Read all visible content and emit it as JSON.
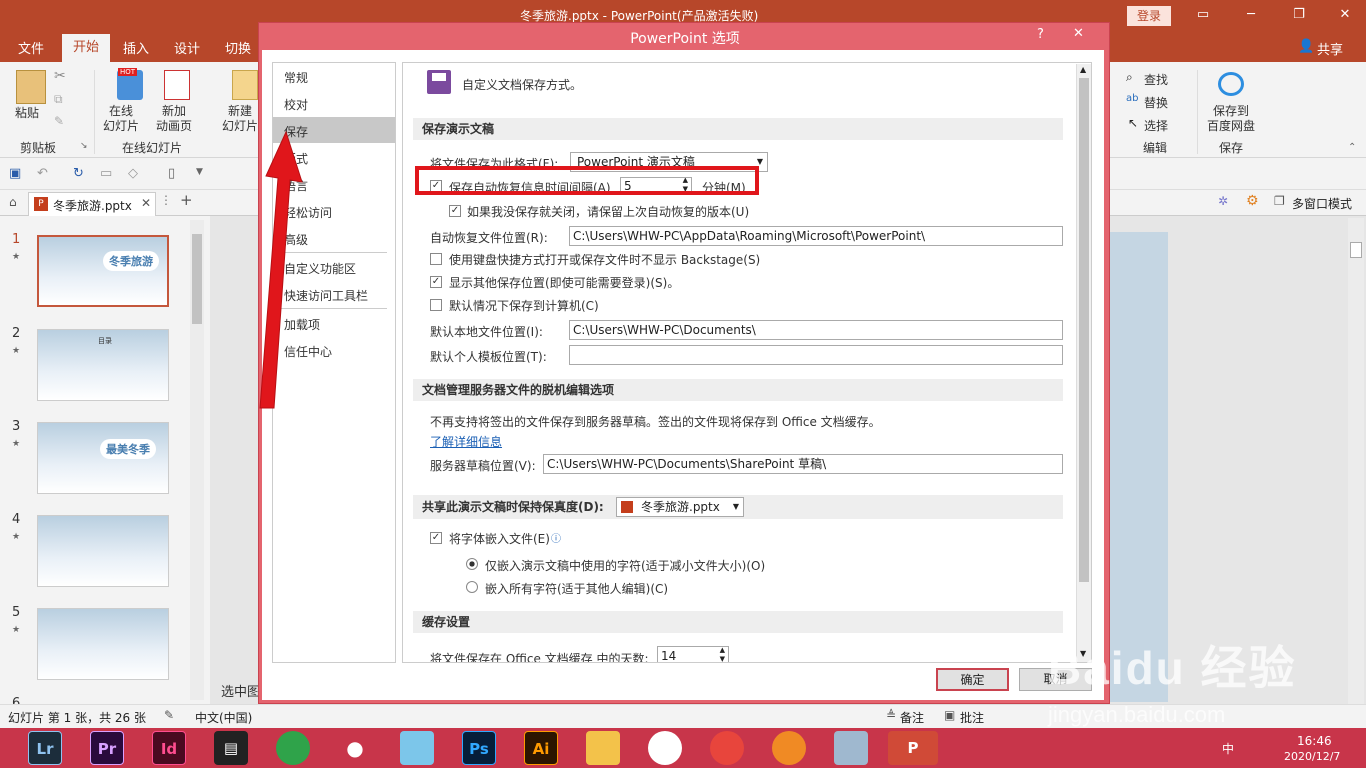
{
  "window": {
    "title": "冬季旅游.pptx  -  PowerPoint(产品激活失败)",
    "login": "登录"
  },
  "ribbon_tabs": [
    "文件",
    "开始",
    "插入",
    "设计",
    "切换"
  ],
  "share": "共享",
  "ribbon": {
    "paste": "粘贴",
    "clipboard_group": "剪贴板",
    "online_slides": "在线\n幻灯片",
    "new_anim_page": "新加\n动画页",
    "online_group": "在线幻灯片",
    "new_slide": "新建\n幻灯片",
    "find": "查找",
    "replace": "替换",
    "select": "选择",
    "edit_group": "编辑",
    "save_baidu": "保存到\n百度网盘",
    "save_group": "保存",
    "hot": "HOT"
  },
  "file_tab": "冬季旅游.pptx",
  "multiwindow": "多窗口模式",
  "thumbnails": [
    {
      "num": "1"
    },
    {
      "num": "2"
    },
    {
      "num": "3"
    },
    {
      "num": "4"
    },
    {
      "num": "5"
    },
    {
      "num": "6"
    }
  ],
  "thumb_text": {
    "t1": "冬季旅游",
    "t3": "最美冬季",
    "t2": "目录"
  },
  "editor_hint": "选中图",
  "status": {
    "slide": "幻灯片 第 1 张，共 26 张",
    "lang": "中文(中国)",
    "notes": "备注",
    "comments": "批注"
  },
  "taskbar": {
    "apps": [
      "Lr",
      "Pr",
      "Id",
      "Ps",
      "Ai"
    ],
    "time": "16:46",
    "date": "2020/12/7",
    "ime": "中"
  },
  "dialog": {
    "title": "PowerPoint 选项",
    "help": "?",
    "close": "✕",
    "nav": [
      "常规",
      "校对",
      "保存",
      "版式",
      "语言",
      "轻松访问",
      "高级",
      "自定义功能区",
      "快速访问工具栏",
      "加载项",
      "信任中心"
    ],
    "header": "自定义文档保存方式。",
    "sec_save": "保存演示文稿",
    "save_format_label": "将文件保存为此格式(F):",
    "save_format_value": "PowerPoint 演示文稿",
    "autorecover_label": "保存自动恢复信息时间间隔(A)",
    "autorecover_value": "5",
    "minutes": "分钟(M)",
    "keep_last": "如果我没保存就关闭，请保留上次自动恢复的版本(U)",
    "autorecover_loc_label": "自动恢复文件位置(R):",
    "autorecover_loc": "C:\\Users\\WHW-PC\\AppData\\Roaming\\Microsoft\\PowerPoint\\",
    "no_backstage": "使用键盘快捷方式打开或保存文件时不显示 Backstage(S)",
    "show_other": "显示其他保存位置(即使可能需要登录)(S)。",
    "save_to_pc": "默认情况下保存到计算机(C)",
    "default_local_label": "默认本地文件位置(I):",
    "default_local": "C:\\Users\\WHW-PC\\Documents\\",
    "template_label": "默认个人模板位置(T):",
    "template_value": "",
    "sec_server": "文档管理服务器文件的脱机编辑选项",
    "server_note": "不再支持将签出的文件保存到服务器草稿。签出的文件现将保存到 Office 文档缓存。",
    "learn_more": "了解详细信息",
    "server_drafts_label": "服务器草稿位置(V):",
    "server_drafts": "C:\\Users\\WHW-PC\\Documents\\SharePoint 草稿\\",
    "sec_share_label": "共享此演示文稿时保持保真度(D):",
    "share_file": "冬季旅游.pptx",
    "embed_fonts": "将字体嵌入文件(E)",
    "embed_used": "仅嵌入演示文稿中使用的字符(适于减小文件大小)(O)",
    "embed_all": "嵌入所有字符(适于其他人编辑)(C)",
    "sec_cache": "缓存设置",
    "cache_days_label": "将文件保存在 Office 文档缓存 中的天数:",
    "cache_days": "14",
    "ok": "确定",
    "cancel": "取消"
  },
  "watermark": "Baidu 经验",
  "watermark_url": "jingyan.baidu.com",
  "colors": {
    "accent": "#b7472a",
    "dialog_frame": "#e4646e",
    "highlight": "#e0161b"
  }
}
